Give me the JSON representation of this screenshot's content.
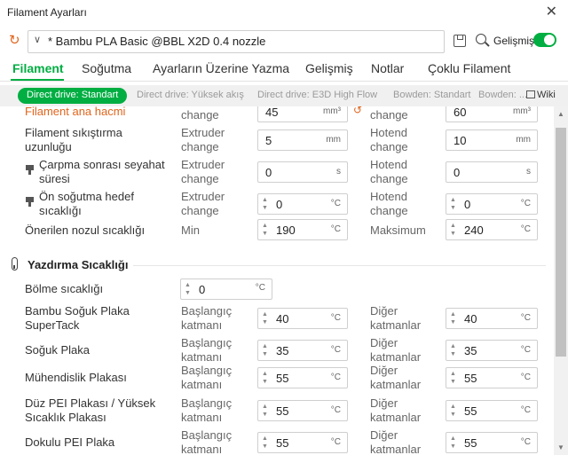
{
  "window": {
    "title": "Filament Ayarları"
  },
  "preset": {
    "name": "* Bambu PLA Basic @BBL X2D 0.4 nozzle",
    "advanced_label": "Gelişmiş"
  },
  "tabs": [
    {
      "label": "Filament"
    },
    {
      "label": "Soğutma"
    },
    {
      "label": "Ayarların Üzerine Yazma"
    },
    {
      "label": "Gelişmiş"
    },
    {
      "label": "Notlar"
    },
    {
      "label": "Çoklu Filament"
    }
  ],
  "chips": [
    {
      "label": "Direct drive: Standart"
    },
    {
      "label": "Direct drive: Yüksek akış"
    },
    {
      "label": "Direct drive: E3D High Flow"
    },
    {
      "label": "Bowden: Standart"
    },
    {
      "label": "Bowden: ..."
    }
  ],
  "wiki_label": "Wiki",
  "rows": [
    {
      "label": "Filament ana hacmi",
      "left_sub": "change",
      "left_value": "45",
      "left_unit": "mm³",
      "right_sub": "change",
      "right_value": "60",
      "right_unit": "mm³"
    },
    {
      "label": "Filament sıkıştırma uzunluğu",
      "left_sub": "Extruder change",
      "left_value": "5",
      "left_unit": "mm",
      "right_sub": "Hotend change",
      "right_value": "10",
      "right_unit": "mm"
    },
    {
      "label": "Çarpma sonrası seyahat süresi",
      "left_sub": "Extruder change",
      "left_value": "0",
      "left_unit": "s",
      "right_sub": "Hotend change",
      "right_value": "0",
      "right_unit": "s"
    },
    {
      "label": "Ön soğutma hedef sıcaklığı",
      "left_sub": "Extruder change",
      "left_value": "0",
      "left_unit": "°C",
      "right_sub": "Hotend change",
      "right_value": "0",
      "right_unit": "°C"
    },
    {
      "label": "Önerilen nozul sıcaklığı",
      "left_sub": "Min",
      "left_value": "190",
      "left_unit": "°C",
      "right_sub": "Maksimum",
      "right_value": "240",
      "right_unit": "°C"
    }
  ],
  "temp_section": {
    "title": "Yazdırma Sıcaklığı",
    "chamber": {
      "label": "Bölme sıcaklığı",
      "value": "0",
      "unit": "°C"
    },
    "plates": [
      {
        "label": "Bambu Soğuk Plaka SuperTack",
        "left_sub": "Başlangıç katmanı",
        "left_value": "40",
        "right_sub": "Diğer katmanlar",
        "right_value": "40",
        "unit": "°C"
      },
      {
        "label": "Soğuk Plaka",
        "left_sub": "Başlangıç katmanı",
        "left_value": "35",
        "right_sub": "Diğer katmanlar",
        "right_value": "35",
        "unit": "°C"
      },
      {
        "label": "Mühendislik Plakası",
        "left_sub": "Başlangıç katmanı",
        "left_value": "55",
        "right_sub": "Diğer katmanlar",
        "right_value": "55",
        "unit": "°C"
      },
      {
        "label": "Düz PEI Plakası / Yüksek Sıcaklık Plakası",
        "left_sub": "Başlangıç katmanı",
        "left_value": "55",
        "right_sub": "Diğer katmanlar",
        "right_value": "55",
        "unit": "°C"
      },
      {
        "label": "Dokulu PEI Plaka",
        "left_sub": "Başlangıç katmanı",
        "left_value": "55",
        "right_sub": "Diğer katmanlar",
        "right_value": "55",
        "unit": "°C"
      }
    ]
  },
  "colors": {
    "accent": "#00ae42",
    "modified": "#e0651d"
  },
  "icons": [
    "reset-icon",
    "save-icon",
    "search-icon",
    "close-icon",
    "thermometer-icon",
    "lock-icon",
    "undo-icon",
    "book-icon"
  ]
}
